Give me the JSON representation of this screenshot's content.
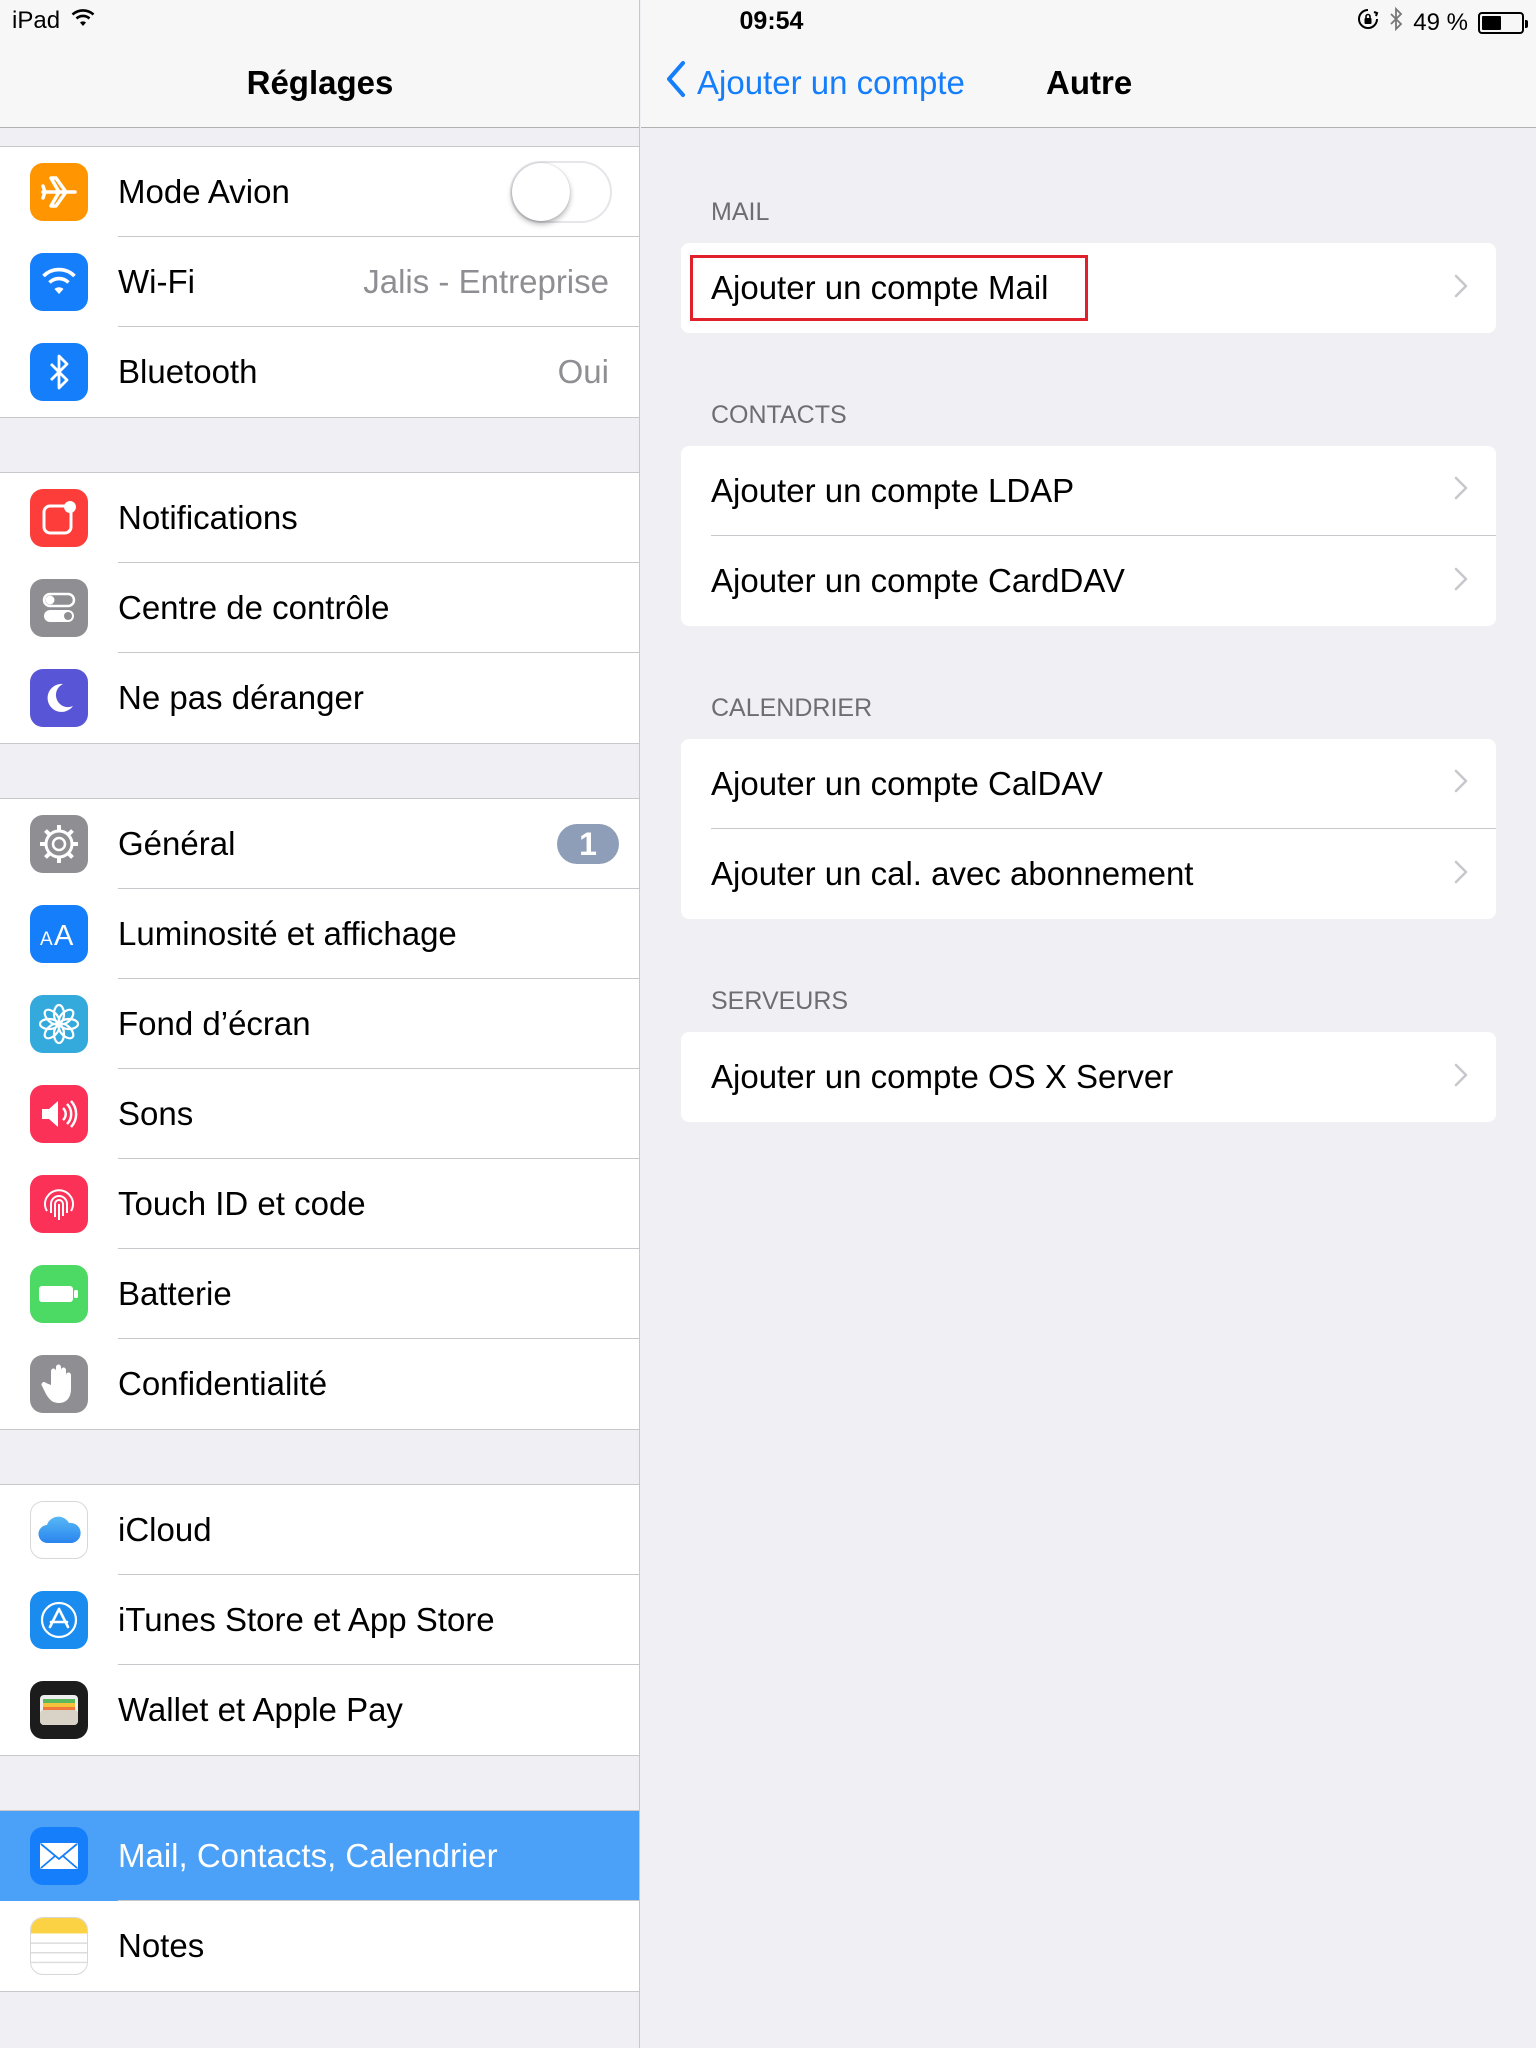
{
  "status_bar": {
    "device": "iPad",
    "time": "09:54",
    "battery": "49 %",
    "battery_level": 0.49
  },
  "sidebar": {
    "title": "Réglages",
    "groups": [
      [
        {
          "label": "Mode Avion",
          "icon": "airplane-icon",
          "color": "#ff9500",
          "toggle": false
        },
        {
          "label": "Wi-Fi",
          "detail": "Jalis - Entreprise",
          "icon": "wifi-icon",
          "color": "#157efb"
        },
        {
          "label": "Bluetooth",
          "detail": "Oui",
          "icon": "bluetooth-icon",
          "color": "#157efb"
        }
      ],
      [
        {
          "label": "Notifications",
          "icon": "notifications-icon",
          "color": "#fc3d39"
        },
        {
          "label": "Centre de contrôle",
          "icon": "control-center-icon",
          "color": "#8e8e93"
        },
        {
          "label": "Ne pas déranger",
          "icon": "moon-icon",
          "color": "#5856d6"
        }
      ],
      [
        {
          "label": "Général",
          "badge": "1",
          "icon": "gear-icon",
          "color": "#8e8e93"
        },
        {
          "label": "Luminosité et affichage",
          "icon": "brightness-icon",
          "color": "#157efb"
        },
        {
          "label": "Fond d’écran",
          "icon": "wallpaper-icon",
          "color": "#34aadc"
        },
        {
          "label": "Sons",
          "icon": "speaker-icon",
          "color": "#fc3158"
        },
        {
          "label": "Touch ID et code",
          "icon": "fingerprint-icon",
          "color": "#fc3158"
        },
        {
          "label": "Batterie",
          "icon": "battery-icon",
          "color": "#4cd964"
        },
        {
          "label": "Confidentialité",
          "icon": "hand-icon",
          "color": "#8e8e93"
        }
      ],
      [
        {
          "label": "iCloud",
          "icon": "cloud-icon",
          "color": "#ffffff"
        },
        {
          "label": "iTunes Store et App Store",
          "icon": "appstore-icon",
          "color": "#1a8cf0"
        },
        {
          "label": "Wallet et Apple Pay",
          "icon": "wallet-icon",
          "color": "#1c1c1c"
        }
      ],
      [
        {
          "label": "Mail, Contacts, Calendrier",
          "icon": "mail-icon",
          "color": "#157efb",
          "selected": true
        },
        {
          "label": "Notes",
          "icon": "notes-icon",
          "color": "#ffffff"
        }
      ]
    ]
  },
  "detail": {
    "back_label": "Ajouter un compte",
    "title": "Autre",
    "sections": [
      {
        "header": "MAIL",
        "items": [
          "Ajouter un compte Mail"
        ]
      },
      {
        "header": "CONTACTS",
        "items": [
          "Ajouter un compte LDAP",
          "Ajouter un compte CardDAV"
        ]
      },
      {
        "header": "CALENDRIER",
        "items": [
          "Ajouter un compte CalDAV",
          "Ajouter un cal. avec abonnement"
        ]
      },
      {
        "header": "SERVEURS",
        "items": [
          "Ajouter un compte OS X Server"
        ]
      }
    ]
  }
}
